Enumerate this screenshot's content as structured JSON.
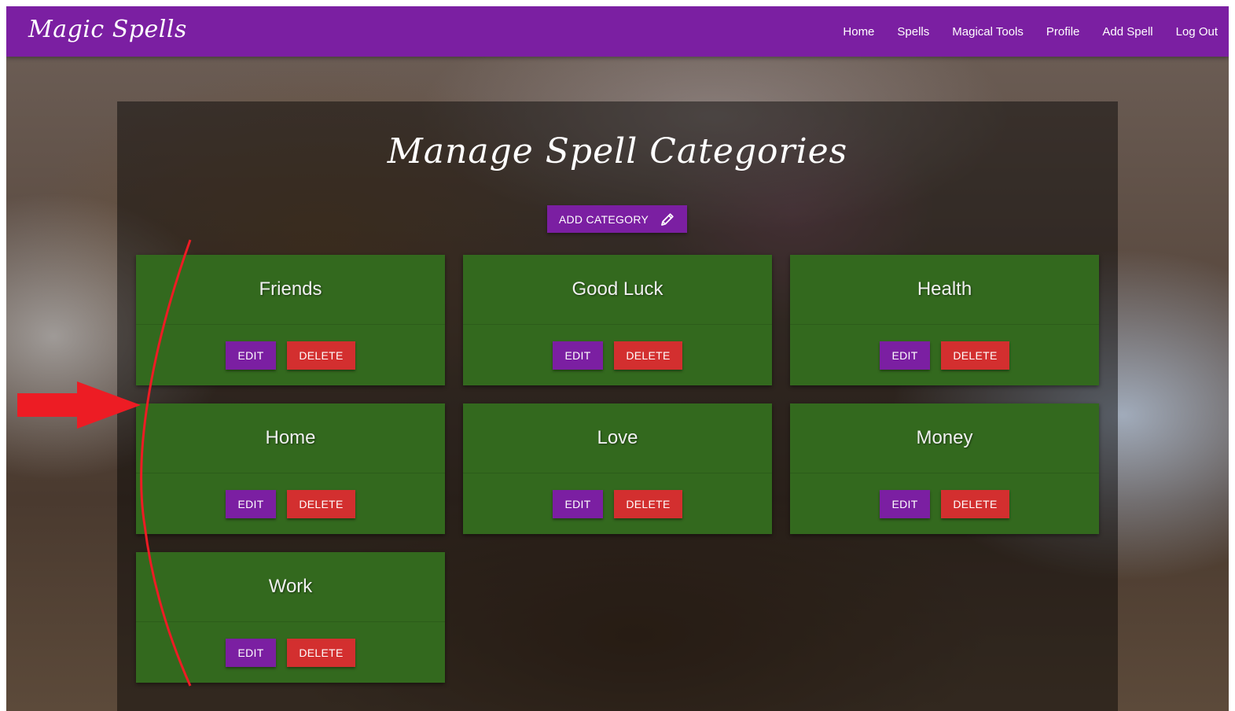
{
  "navbar": {
    "brand": "Magic Spells",
    "links": [
      "Home",
      "Spells",
      "Magical Tools",
      "Profile",
      "Add Spell",
      "Log Out"
    ],
    "color": "#7b1fa2"
  },
  "page": {
    "title": "Manage Spell Categories",
    "add_button": "ADD CATEGORY",
    "add_icon": "pencil-icon"
  },
  "categories": [
    {
      "name": "Friends"
    },
    {
      "name": "Good Luck"
    },
    {
      "name": "Health"
    },
    {
      "name": "Home"
    },
    {
      "name": "Love"
    },
    {
      "name": "Money"
    },
    {
      "name": "Work"
    }
  ],
  "card": {
    "edit_label": "EDIT",
    "delete_label": "DELETE",
    "card_color": "#33691e",
    "edit_color": "#7b1fa2",
    "delete_color": "#d32f2f"
  },
  "annotation": {
    "color": "#ed1c24",
    "shapes": [
      "arrow",
      "curved-line"
    ]
  }
}
